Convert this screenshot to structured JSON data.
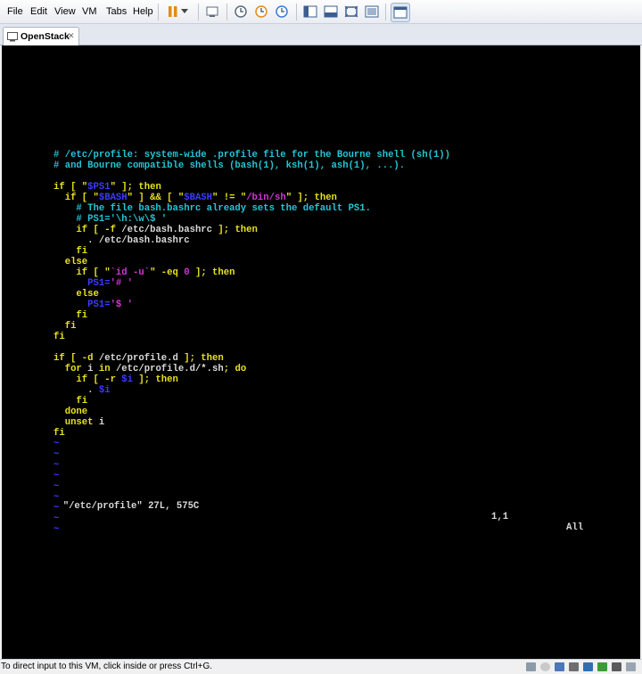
{
  "menu": {
    "file": "File",
    "edit": "Edit",
    "view": "View",
    "vm": "VM",
    "tabs": "Tabs",
    "help": "Help"
  },
  "tab": {
    "label": "OpenStack",
    "close": "✕"
  },
  "terminal": {
    "lines": [
      [
        [
          "c",
          "# /etc/profile: system-wide .profile file for the Bourne shell (sh(1))"
        ]
      ],
      [
        [
          "c",
          "# and Bourne compatible shells (bash(1), ksh(1), ash(1), ...)."
        ]
      ],
      [
        [
          "w",
          ""
        ]
      ],
      [
        [
          "y",
          "if [ \""
        ],
        [
          "b",
          "$PS1"
        ],
        [
          "y",
          "\" ]; then"
        ]
      ],
      [
        [
          "y",
          "  if [ \""
        ],
        [
          "b",
          "$BASH"
        ],
        [
          "y",
          "\" ] && [ \""
        ],
        [
          "b",
          "$BASH"
        ],
        [
          "y",
          "\" != \""
        ],
        [
          "m",
          "/bin/sh"
        ],
        [
          "y",
          "\" ]; then"
        ]
      ],
      [
        [
          "c",
          "    # The file bash.bashrc already sets the default PS1."
        ]
      ],
      [
        [
          "c",
          "    # PS1='\\h:\\w\\$ '"
        ]
      ],
      [
        [
          "y",
          "    if [ -f "
        ],
        [
          "w",
          "/etc/bash.bashrc"
        ],
        [
          "y",
          " ]; then"
        ]
      ],
      [
        [
          "w",
          "      . /etc/bash.bashrc"
        ]
      ],
      [
        [
          "y",
          "    fi"
        ]
      ],
      [
        [
          "y",
          "  else"
        ]
      ],
      [
        [
          "y",
          "    if [ \""
        ],
        [
          "m",
          "`id -u`"
        ],
        [
          "y",
          "\" -eq "
        ],
        [
          "m",
          "0"
        ],
        [
          "y",
          " ]; then"
        ]
      ],
      [
        [
          "b",
          "      PS1="
        ],
        [
          "m",
          "'# '"
        ]
      ],
      [
        [
          "y",
          "    else"
        ]
      ],
      [
        [
          "b",
          "      PS1="
        ],
        [
          "m",
          "'$ '"
        ]
      ],
      [
        [
          "y",
          "    fi"
        ]
      ],
      [
        [
          "y",
          "  fi"
        ]
      ],
      [
        [
          "y",
          "fi"
        ]
      ],
      [
        [
          "w",
          ""
        ]
      ],
      [
        [
          "y",
          "if [ -d "
        ],
        [
          "w",
          "/etc/profile.d"
        ],
        [
          "y",
          " ]; then"
        ]
      ],
      [
        [
          "y",
          "  for "
        ],
        [
          "w",
          "i"
        ],
        [
          "y",
          " in "
        ],
        [
          "w",
          "/etc/profile.d/*.sh"
        ],
        [
          "y",
          "; do"
        ]
      ],
      [
        [
          "y",
          "    if [ -r "
        ],
        [
          "b",
          "$i"
        ],
        [
          "y",
          " ]; then"
        ]
      ],
      [
        [
          "w",
          "      . "
        ],
        [
          "b",
          "$i"
        ]
      ],
      [
        [
          "y",
          "    fi"
        ]
      ],
      [
        [
          "y",
          "  done"
        ]
      ],
      [
        [
          "y",
          "  unset "
        ],
        [
          "w",
          "i"
        ]
      ],
      [
        [
          "y",
          "fi"
        ]
      ],
      [
        [
          "tl",
          "~"
        ]
      ],
      [
        [
          "tl",
          "~"
        ]
      ],
      [
        [
          "tl",
          "~"
        ]
      ],
      [
        [
          "tl",
          "~"
        ]
      ],
      [
        [
          "tl",
          "~"
        ]
      ],
      [
        [
          "tl",
          "~"
        ]
      ],
      [
        [
          "tl",
          "~"
        ]
      ],
      [
        [
          "tl",
          "~"
        ]
      ],
      [
        [
          "tl",
          "~"
        ]
      ]
    ]
  },
  "status": {
    "file": "\"/etc/profile\" 27L, 575C",
    "position": "1,1",
    "scroll": "All"
  },
  "bottom": {
    "hint": "To direct input to this VM, click inside or press Ctrl+G."
  },
  "colors": {
    "comment": "#21c6d6",
    "keyword": "#e8e21b",
    "string": "#d336d6",
    "variable": "#3b3bff"
  }
}
